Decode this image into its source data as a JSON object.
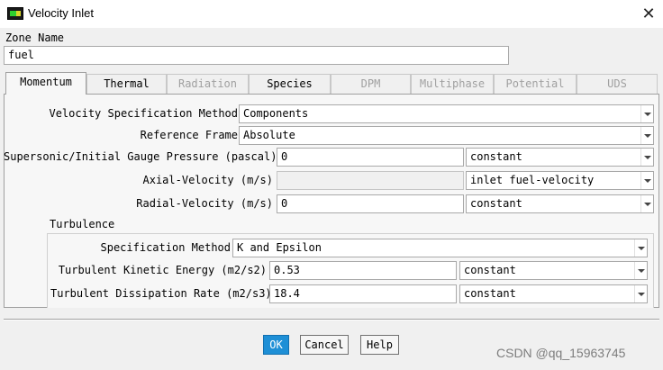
{
  "window": {
    "title": "Velocity Inlet",
    "close_glyph": "✕"
  },
  "zone": {
    "label": "Zone Name",
    "value": "fuel"
  },
  "tabs": [
    {
      "label": "Momentum",
      "active": true,
      "enabled": true
    },
    {
      "label": "Thermal",
      "active": false,
      "enabled": true
    },
    {
      "label": "Radiation",
      "active": false,
      "enabled": false
    },
    {
      "label": "Species",
      "active": false,
      "enabled": true
    },
    {
      "label": "DPM",
      "active": false,
      "enabled": false
    },
    {
      "label": "Multiphase",
      "active": false,
      "enabled": false
    },
    {
      "label": "Potential",
      "active": false,
      "enabled": false
    },
    {
      "label": "UDS",
      "active": false,
      "enabled": false
    }
  ],
  "momentum": {
    "velocity_spec_method": {
      "label": "Velocity Specification Method",
      "value": "Components"
    },
    "reference_frame": {
      "label": "Reference Frame",
      "value": "Absolute"
    },
    "gauge_pressure": {
      "label": "Supersonic/Initial Gauge Pressure (pascal)",
      "value": "0",
      "profile": "constant"
    },
    "axial_velocity": {
      "label": "Axial-Velocity (m/s)",
      "value": "",
      "profile": "inlet fuel-velocity"
    },
    "radial_velocity": {
      "label": "Radial-Velocity (m/s)",
      "value": "0",
      "profile": "constant"
    }
  },
  "turbulence": {
    "section_label": "Turbulence",
    "spec_method": {
      "label": "Specification Method",
      "value": "K and Epsilon"
    },
    "kinetic_energy": {
      "label": "Turbulent Kinetic Energy (m2/s2)",
      "value": "0.53",
      "profile": "constant"
    },
    "dissipation_rate": {
      "label": "Turbulent Dissipation Rate (m2/s3)",
      "value": "18.4",
      "profile": "constant"
    }
  },
  "buttons": {
    "ok": "OK",
    "cancel": "Cancel",
    "help": "Help"
  },
  "watermark": "CSDN @qq_15963745",
  "colors": {
    "ok_button": "#1e8fd6",
    "icon_green": "#2fd12f",
    "icon_yellow": "#d9d92a"
  }
}
